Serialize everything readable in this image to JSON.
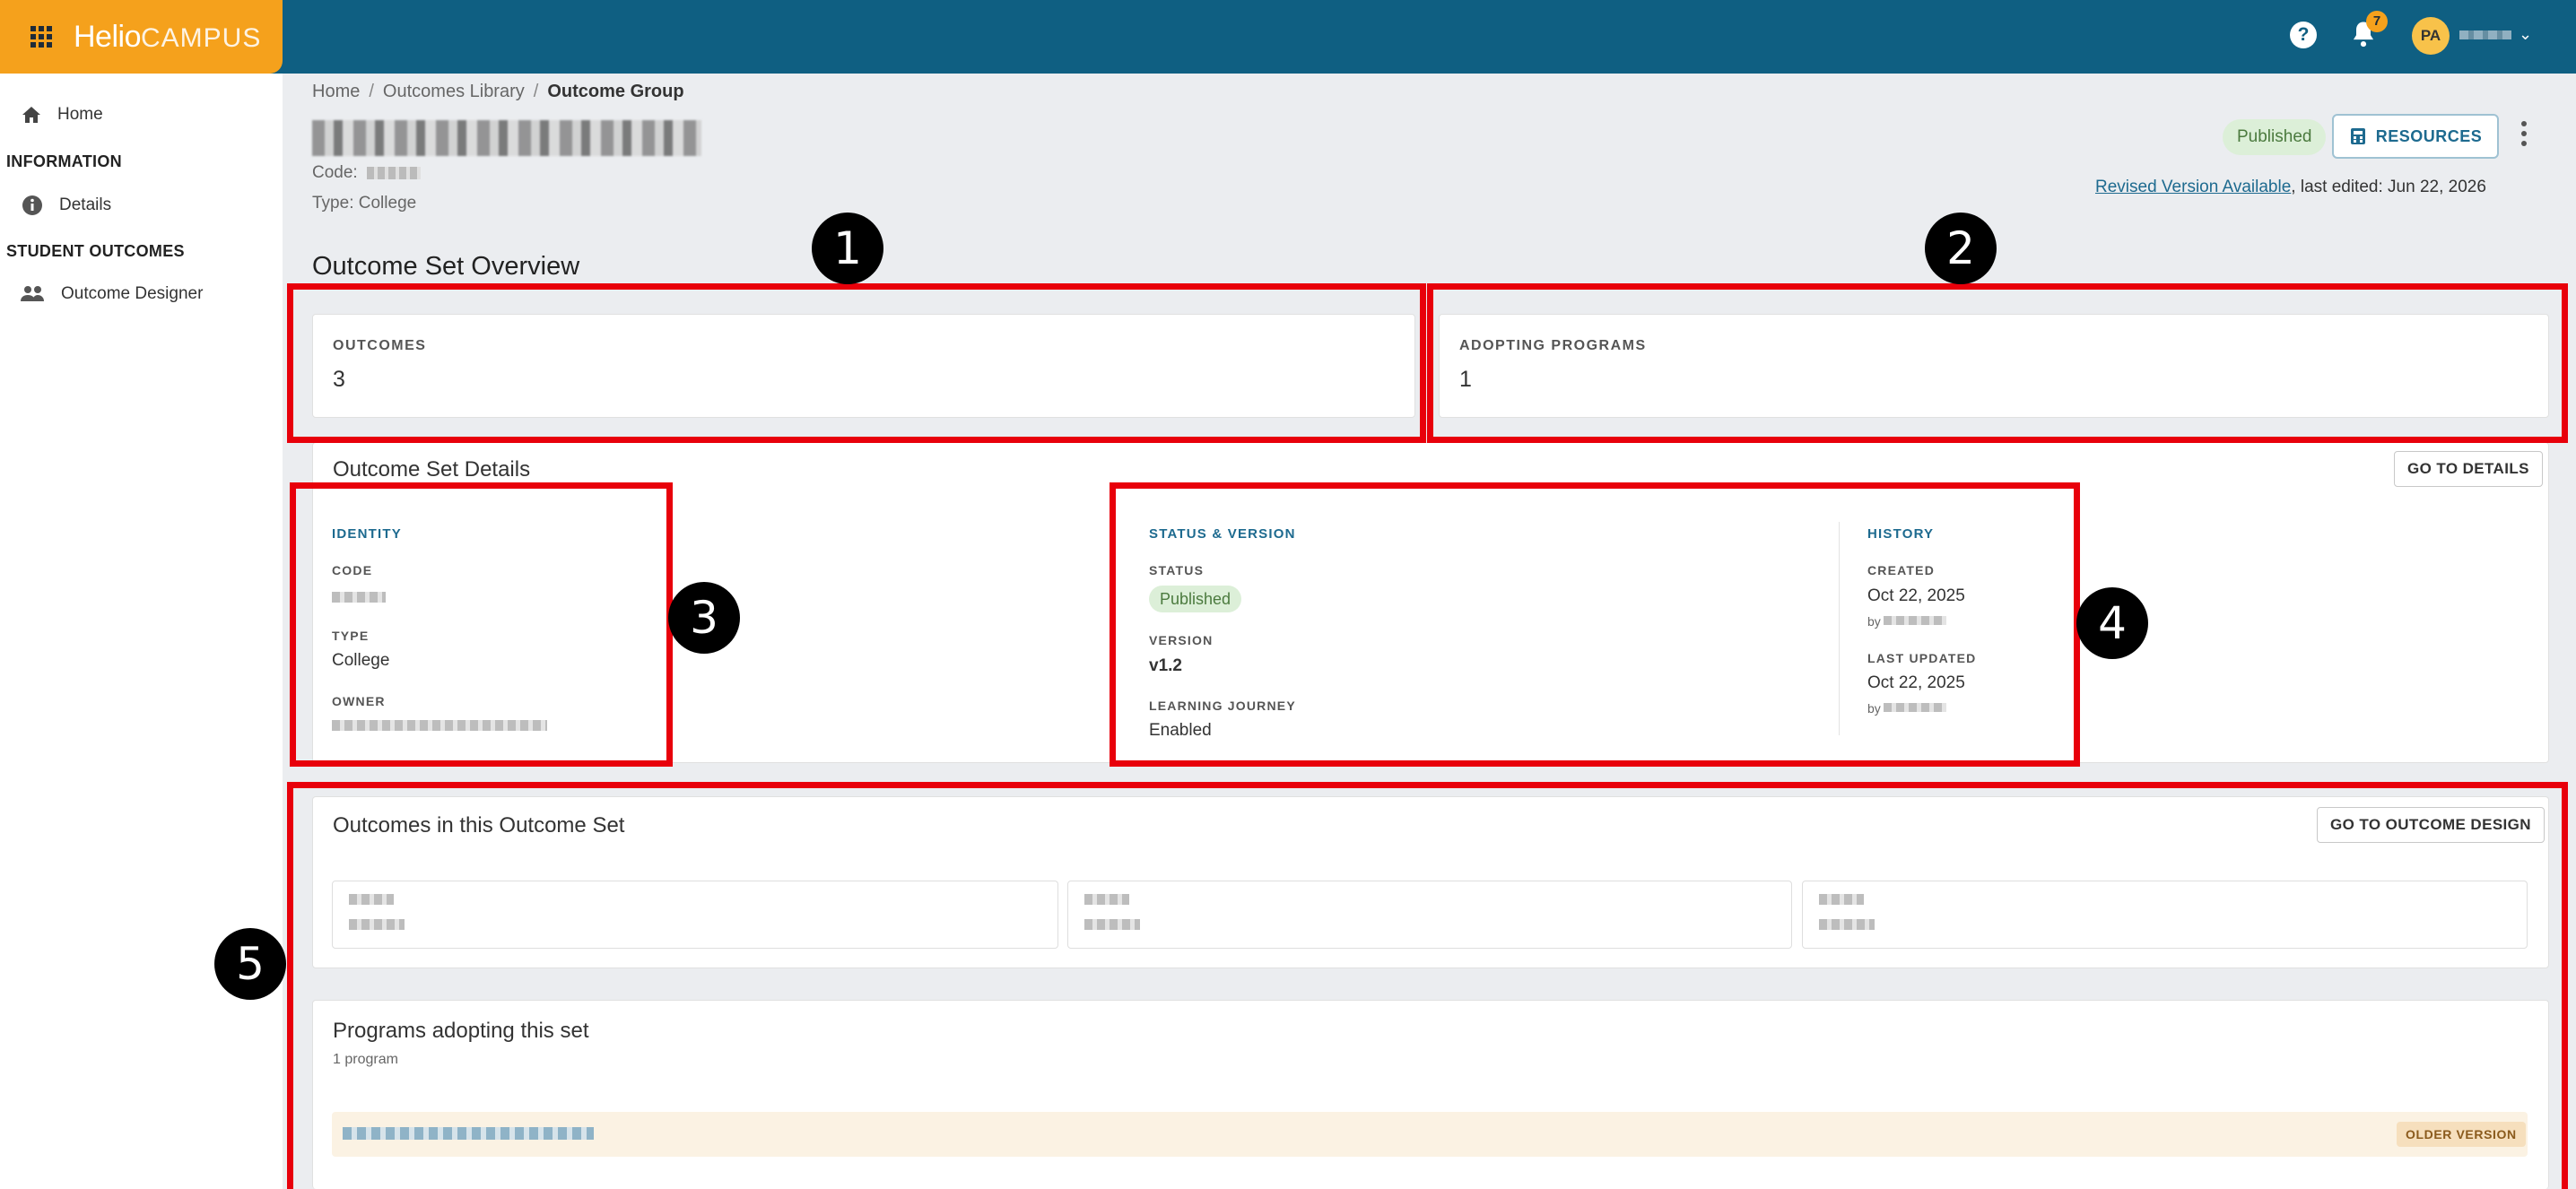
{
  "header": {
    "brand_main": "Helio",
    "brand_sub": "CAMPUS",
    "help_label": "?",
    "notification_count": "7",
    "user_initials": "PA"
  },
  "sidebar": {
    "home": "Home",
    "section_information": "INFORMATION",
    "details": "Details",
    "section_student_outcomes": "STUDENT OUTCOMES",
    "outcome_designer": "Outcome Designer"
  },
  "breadcrumb": {
    "home": "Home",
    "library": "Outcomes Library",
    "current": "Outcome Group",
    "separator": "/"
  },
  "page": {
    "code_label": "Code:",
    "type_label": "Type:",
    "type_value": "College",
    "status_pill": "Published",
    "resources_label": "RESOURCES",
    "revised_link": "Revised Version Available",
    "last_edited": ", last edited: Jun 22, 2026"
  },
  "overview": {
    "title": "Outcome Set Overview",
    "outcomes_label": "OUTCOMES",
    "outcomes_value": "3",
    "adopting_label": "ADOPTING PROGRAMS",
    "adopting_value": "1"
  },
  "details": {
    "title": "Outcome Set Details",
    "go_to_details": "GO TO DETAILS",
    "identity_heading": "IDENTITY",
    "code_label": "CODE",
    "type_label": "TYPE",
    "type_value": "College",
    "owner_label": "OWNER",
    "status_heading": "STATUS & VERSION",
    "status_label": "STATUS",
    "status_value": "Published",
    "version_label": "VERSION",
    "version_value": "v1.2",
    "journey_label": "LEARNING JOURNEY",
    "journey_value": "Enabled",
    "history_heading": "HISTORY",
    "created_label": "CREATED",
    "created_value": "Oct 22, 2025",
    "by_label": "by",
    "updated_label": "LAST UPDATED",
    "updated_value": "Oct 22, 2025"
  },
  "outcomes_section": {
    "title": "Outcomes in this Outcome Set",
    "go_to_design": "GO TO OUTCOME DESIGN"
  },
  "programs_section": {
    "title": "Programs adopting this set",
    "count": "1 program",
    "older_version": "OLDER VERSION"
  },
  "annotations": [
    "1",
    "2",
    "3",
    "4",
    "5"
  ],
  "colors": {
    "topbar": "#0f5f82",
    "brand": "#f5a11c",
    "highlight": "#e8000b",
    "accent": "#1d6a8f",
    "published_bg": "#dcefd8"
  }
}
